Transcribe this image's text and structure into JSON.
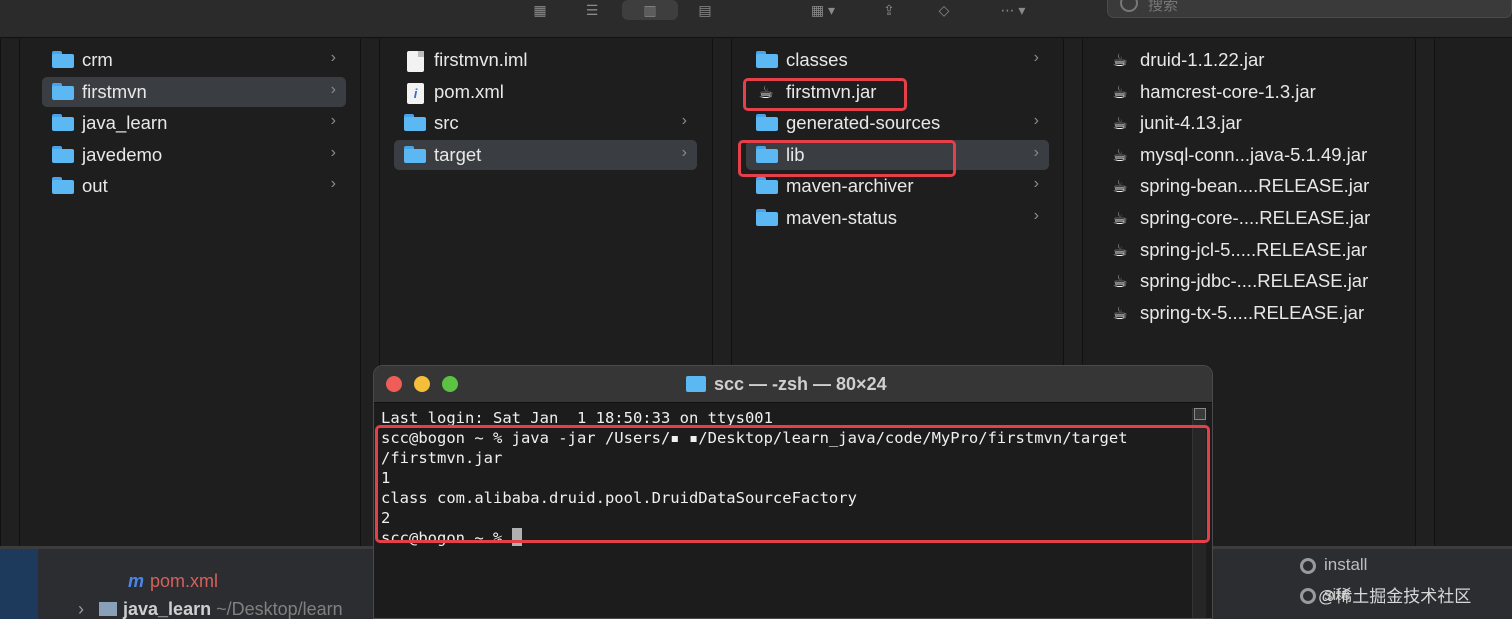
{
  "toolbar": {
    "search_placeholder": "搜索"
  },
  "columns": [
    {
      "items": [
        {
          "label": "crm",
          "type": "folder",
          "chevron": true,
          "selected": false
        },
        {
          "label": "firstmvn",
          "type": "folder",
          "chevron": true,
          "selected": true
        },
        {
          "label": "java_learn",
          "type": "folder",
          "chevron": true,
          "selected": false
        },
        {
          "label": "javedemo",
          "type": "folder",
          "chevron": true,
          "selected": false
        },
        {
          "label": "out",
          "type": "folder",
          "chevron": true,
          "selected": false
        }
      ]
    },
    {
      "items": [
        {
          "label": "firstmvn.iml",
          "type": "file",
          "chevron": false,
          "selected": false
        },
        {
          "label": "pom.xml",
          "type": "pom",
          "chevron": false,
          "selected": false
        },
        {
          "label": "src",
          "type": "folder",
          "chevron": true,
          "selected": false
        },
        {
          "label": "target",
          "type": "folder",
          "chevron": true,
          "selected": true
        }
      ]
    },
    {
      "items": [
        {
          "label": "classes",
          "type": "folder",
          "chevron": true,
          "selected": false
        },
        {
          "label": "firstmvn.jar",
          "type": "jar",
          "chevron": false,
          "selected": false
        },
        {
          "label": "generated-sources",
          "type": "folder",
          "chevron": true,
          "selected": false
        },
        {
          "label": "lib",
          "type": "folder",
          "chevron": true,
          "selected": true
        },
        {
          "label": "maven-archiver",
          "type": "folder",
          "chevron": true,
          "selected": false
        },
        {
          "label": "maven-status",
          "type": "folder",
          "chevron": true,
          "selected": false
        }
      ]
    },
    {
      "items": [
        {
          "label": "druid-1.1.22.jar",
          "type": "jar"
        },
        {
          "label": "hamcrest-core-1.3.jar",
          "type": "jar"
        },
        {
          "label": "junit-4.13.jar",
          "type": "jar"
        },
        {
          "label": "mysql-conn...java-5.1.49.jar",
          "type": "jar"
        },
        {
          "label": "spring-bean....RELEASE.jar",
          "type": "jar"
        },
        {
          "label": "spring-core-....RELEASE.jar",
          "type": "jar"
        },
        {
          "label": "spring-jcl-5.....RELEASE.jar",
          "type": "jar"
        },
        {
          "label": "spring-jdbc-....RELEASE.jar",
          "type": "jar"
        },
        {
          "label": "spring-tx-5.....RELEASE.jar",
          "type": "jar"
        }
      ]
    }
  ],
  "terminal": {
    "title": "scc — -zsh — 80×24",
    "lines": [
      "Last login: Sat Jan  1 18:50:33 on ttys001",
      "scc@bogon ~ % java -jar /Users/▪ ▪/Desktop/learn_java/code/MyPro/firstmvn/target",
      "/firstmvn.jar",
      "1",
      "class com.alibaba.druid.pool.DruidDataSourceFactory",
      "2",
      "scc@bogon ~ % "
    ]
  },
  "ide": {
    "pom_label": "pom.xml",
    "project_name": "java_learn",
    "project_path": "~/Desktop/learn",
    "right_items": [
      "install",
      "site"
    ],
    "watermark": "@稀土掘金技术社区"
  },
  "colors": {
    "highlight": "#e5404a",
    "folder": "#5cb8f3",
    "selection": "#3a3d42"
  }
}
